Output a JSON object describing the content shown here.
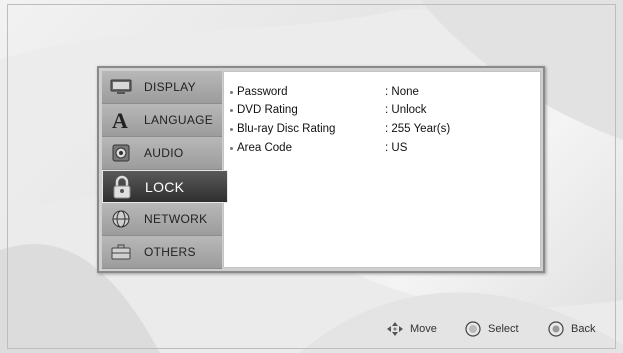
{
  "sidebar": {
    "items": [
      {
        "label": "DISPLAY",
        "icon": "display-icon",
        "active": false
      },
      {
        "label": "LANGUAGE",
        "icon": "language-icon",
        "active": false
      },
      {
        "label": "AUDIO",
        "icon": "audio-icon",
        "active": false
      },
      {
        "label": "LOCK",
        "icon": "lock-icon",
        "active": true
      },
      {
        "label": "NETWORK",
        "icon": "network-icon",
        "active": false
      },
      {
        "label": "OTHERS",
        "icon": "others-icon",
        "active": false
      }
    ]
  },
  "lock_settings": {
    "rows": [
      {
        "key": "Password",
        "value": ": None"
      },
      {
        "key": "DVD Rating",
        "value": ": Unlock"
      },
      {
        "key": "Blu-ray Disc Rating",
        "value": ": 255 Year(s)"
      },
      {
        "key": "Area Code",
        "value": ": US"
      }
    ]
  },
  "footer": {
    "move_label": "Move",
    "select_label": "Select",
    "back_label": "Back"
  },
  "colors": {
    "active_item_bg": "#3a3a3a",
    "sidebar_bg": "#a8a8a8",
    "content_bg": "#ffffff"
  }
}
